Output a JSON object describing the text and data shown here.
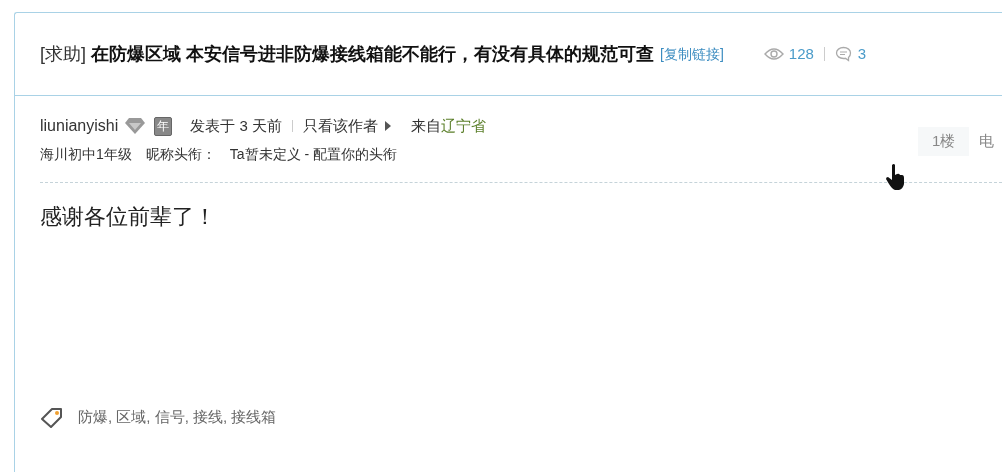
{
  "thread": {
    "prefix": "[求助]",
    "title": "在防爆区域 本安信号进非防爆接线箱能不能行，有没有具体的规范可查",
    "copy_link": "[复制链接]",
    "views": "128",
    "replies": "3"
  },
  "post": {
    "author": "liunianyishi",
    "year_badge": "年",
    "posted": "发表于 3 天前",
    "only_author": "只看该作者",
    "from_label": "来自",
    "location": "辽宁省",
    "rank": "海川初中1年级",
    "nick_title_label": "昵称头衔：",
    "nick_title": "Ta暂未定义 - 配置你的头衔",
    "floor": "1楼",
    "floor_extra": "电",
    "body": "感谢各位前辈了！",
    "tags": "防爆, 区域, 信号, 接线, 接线箱"
  }
}
